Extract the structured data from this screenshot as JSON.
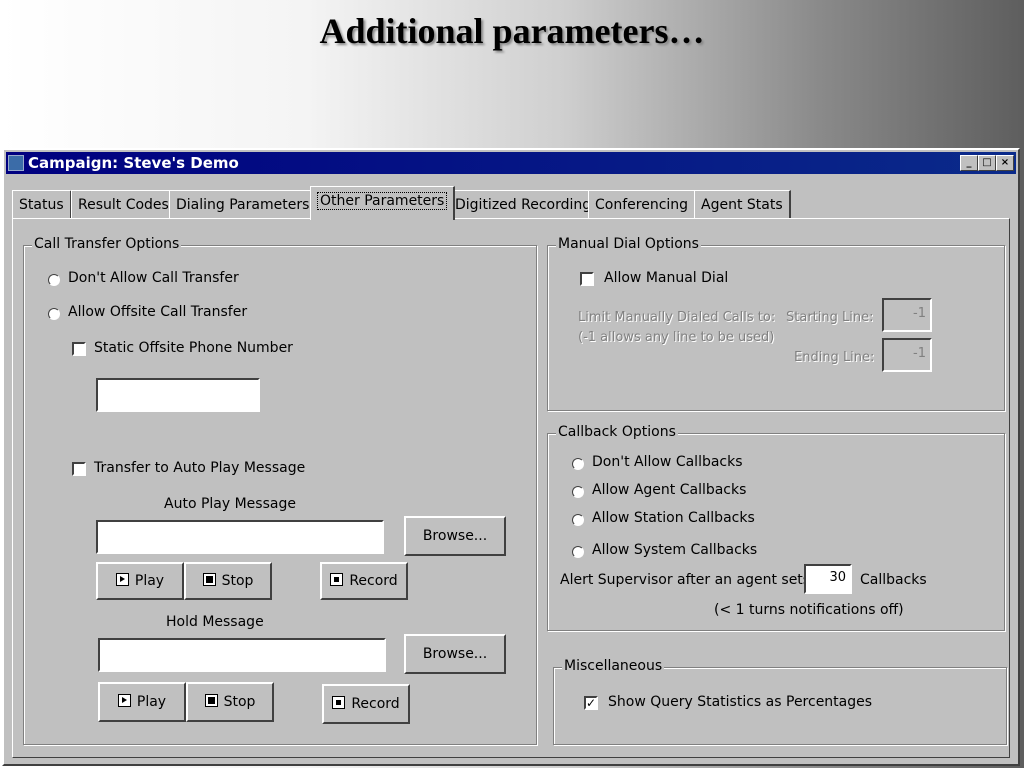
{
  "slide": {
    "title": "Additional parameters…"
  },
  "window": {
    "title": "Campaign: Steve's Demo",
    "buttons": {
      "minimize": "_",
      "maximize": "□",
      "close": "×"
    }
  },
  "tabs": [
    {
      "label": "Status"
    },
    {
      "label": "Result Codes"
    },
    {
      "label": "Dialing Parameters"
    },
    {
      "label": "Other Parameters",
      "active": true
    },
    {
      "label": "Digitized Recording"
    },
    {
      "label": "Conferencing"
    },
    {
      "label": "Agent Stats"
    }
  ],
  "call_transfer": {
    "legend": "Call Transfer Options",
    "dont_allow": "Don't Allow Call Transfer",
    "allow_offsite": "Allow Offsite Call Transfer",
    "static_phone": "Static Offsite Phone Number",
    "static_phone_value": "",
    "transfer_auto_play": "Transfer to Auto Play Message",
    "auto_play_label": "Auto Play Message",
    "auto_play_value": "",
    "hold_label": "Hold Message",
    "hold_value": "",
    "browse": "Browse...",
    "play": "Play",
    "stop": "Stop",
    "record": "Record"
  },
  "manual_dial": {
    "legend": "Manual Dial Options",
    "allow": "Allow Manual Dial",
    "limit_line1": "Limit Manually Dialed Calls to:",
    "limit_line2": "(-1 allows any line to be used)",
    "starting_label": "Starting Line:",
    "starting_value": "-1",
    "ending_label": "Ending Line:",
    "ending_value": "-1"
  },
  "callback": {
    "legend": "Callback Options",
    "dont_allow": "Don't Allow Callbacks",
    "agent": "Allow Agent Callbacks",
    "station": "Allow Station Callbacks",
    "system": "Allow System Callbacks",
    "alert_prefix": "Alert Supervisor after an agent sets",
    "alert_value": "30",
    "alert_suffix": "Callbacks",
    "alert_note": "(< 1 turns notifications off)"
  },
  "misc": {
    "legend": "Miscellaneous",
    "show_query": "Show Query Statistics as Percentages",
    "show_query_checked": "✓"
  }
}
